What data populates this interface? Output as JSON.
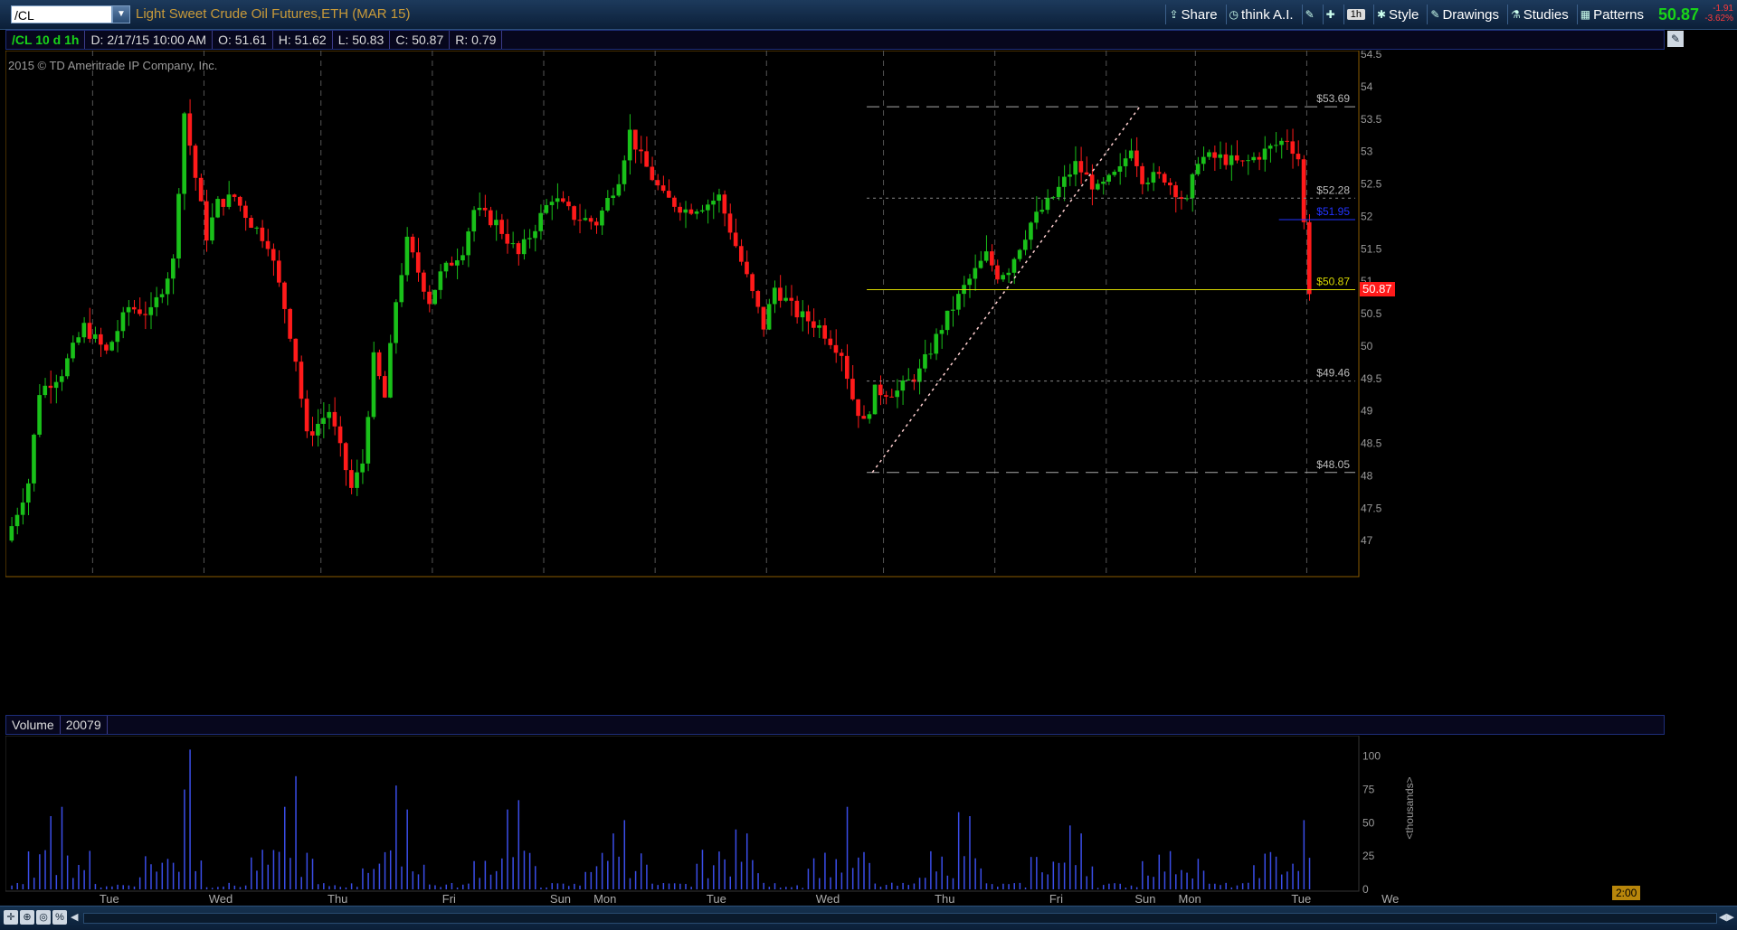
{
  "header": {
    "symbol": "/CL",
    "description": "Light Sweet Crude Oil Futures,ETH (MAR 15)",
    "toolbar": [
      {
        "name": "share-button",
        "icon": "share-icon",
        "label": "Share"
      },
      {
        "name": "think-ai-button",
        "icon": "think-icon",
        "label": "think A.I."
      },
      {
        "name": "drawing-tools-button",
        "icon": "pencil-icon",
        "label": ""
      },
      {
        "name": "settings-button",
        "icon": "wrench-icon",
        "label": ""
      },
      {
        "name": "timeframe-button",
        "icon": "",
        "label": "1h"
      },
      {
        "name": "style-button",
        "icon": "gear-icon",
        "label": "Style"
      },
      {
        "name": "drawings-button",
        "icon": "pencil-icon",
        "label": "Drawings"
      },
      {
        "name": "studies-button",
        "icon": "flask-icon",
        "label": "Studies"
      },
      {
        "name": "patterns-button",
        "icon": "patterns-icon",
        "label": "Patterns"
      }
    ],
    "last_price": "50.87",
    "change": "-1.91",
    "change_pct": "-3.62%"
  },
  "infobar": {
    "symbol": "/CL 10 d 1h",
    "date": "D: 2/17/15 10:00 AM",
    "open": "O: 51.61",
    "high": "H: 51.62",
    "low": "L: 50.83",
    "close": "C: 50.87",
    "range": "R: 0.79"
  },
  "copyright": "2015 © TD Ameritrade IP Company, Inc.",
  "volume_header": {
    "label": "Volume",
    "value": "20079"
  },
  "time_tag": "2:00",
  "colors": {
    "up": "#19c019",
    "down": "#ff1a1a",
    "volume": "#3a4de8",
    "grid": "#555555",
    "hline": "#d8d800",
    "blue_line": "#2233ff"
  },
  "chart_data": {
    "type": "candlestick",
    "price_axis": {
      "min": 46.5,
      "max": 54.5,
      "ticks": [
        "47",
        "47.5",
        "48",
        "48.5",
        "49",
        "49.5",
        "50",
        "50.5",
        "51",
        "51.5",
        "52",
        "52.5",
        "53",
        "53.5",
        "54",
        "54.5"
      ]
    },
    "volume_axis": {
      "min": 0,
      "max": 110,
      "ticks": [
        "0",
        "25",
        "50",
        "75",
        "100"
      ],
      "unit_label": "<thousands>"
    },
    "x_labels": [
      "Tue",
      "Wed",
      "Thu",
      "Fri",
      "Sun",
      "Mon",
      "Tue",
      "Wed",
      "Thu",
      "Fri",
      "Sun",
      "Mon",
      "Tue",
      "We"
    ],
    "x_label_bars": [
      18,
      38,
      59,
      79,
      99,
      107,
      127,
      147,
      168,
      188,
      204,
      212,
      232,
      248
    ],
    "session_dividers": [
      15,
      35,
      56,
      76,
      96,
      116,
      136,
      157,
      177,
      197,
      213,
      233
    ],
    "horizontal_lines": [
      {
        "label": "$53.69",
        "value": 53.69,
        "style": "dashed"
      },
      {
        "label": "$52.28",
        "value": 52.28,
        "style": "dotted"
      },
      {
        "label": "$51.95",
        "value": 51.95,
        "style": "solid-blue"
      },
      {
        "label": "$50.87",
        "value": 50.87,
        "style": "solid-yellow"
      },
      {
        "label": "$49.46",
        "value": 49.46,
        "style": "dotted"
      },
      {
        "label": "$48.05",
        "value": 48.05,
        "style": "dashed"
      }
    ],
    "trendline": {
      "from_bar": 155,
      "from": 48.05,
      "to_bar": 203,
      "to": 53.69
    },
    "current_price_tag": "50.87",
    "bar_count": 234,
    "close_anchors": [
      [
        0,
        47.0
      ],
      [
        4,
        47.9
      ],
      [
        6,
        49.3
      ],
      [
        10,
        49.6
      ],
      [
        14,
        50.3
      ],
      [
        18,
        49.9
      ],
      [
        22,
        50.6
      ],
      [
        26,
        50.5
      ],
      [
        30,
        51.3
      ],
      [
        32,
        53.6
      ],
      [
        34,
        52.6
      ],
      [
        36,
        51.7
      ],
      [
        38,
        52.2
      ],
      [
        41,
        52.3
      ],
      [
        44,
        51.9
      ],
      [
        47,
        51.6
      ],
      [
        50,
        50.6
      ],
      [
        52,
        49.8
      ],
      [
        54,
        48.6
      ],
      [
        58,
        49.0
      ],
      [
        62,
        47.8
      ],
      [
        64,
        48.2
      ],
      [
        66,
        49.8
      ],
      [
        68,
        49.2
      ],
      [
        70,
        50.7
      ],
      [
        72,
        51.6
      ],
      [
        76,
        50.7
      ],
      [
        78,
        51.1
      ],
      [
        82,
        51.5
      ],
      [
        84,
        52.1
      ],
      [
        88,
        51.9
      ],
      [
        92,
        51.4
      ],
      [
        96,
        52.0
      ],
      [
        98,
        52.3
      ],
      [
        102,
        52.0
      ],
      [
        106,
        51.9
      ],
      [
        110,
        52.6
      ],
      [
        112,
        53.3
      ],
      [
        114,
        52.9
      ],
      [
        118,
        52.3
      ],
      [
        122,
        52.1
      ],
      [
        126,
        52.2
      ],
      [
        128,
        52.3
      ],
      [
        132,
        51.3
      ],
      [
        136,
        50.3
      ],
      [
        138,
        50.9
      ],
      [
        142,
        50.5
      ],
      [
        146,
        50.3
      ],
      [
        150,
        49.9
      ],
      [
        152,
        49.2
      ],
      [
        154,
        48.8
      ],
      [
        156,
        49.3
      ],
      [
        160,
        49.3
      ],
      [
        164,
        49.6
      ],
      [
        168,
        50.3
      ],
      [
        172,
        50.9
      ],
      [
        176,
        51.4
      ],
      [
        178,
        51.1
      ],
      [
        180,
        51.2
      ],
      [
        184,
        51.9
      ],
      [
        188,
        52.3
      ],
      [
        192,
        52.8
      ],
      [
        196,
        52.4
      ],
      [
        200,
        52.7
      ],
      [
        202,
        53.1
      ],
      [
        204,
        52.6
      ],
      [
        208,
        52.6
      ],
      [
        212,
        52.2
      ],
      [
        214,
        52.9
      ],
      [
        218,
        52.9
      ],
      [
        222,
        52.8
      ],
      [
        226,
        53.0
      ],
      [
        230,
        53.2
      ],
      [
        232,
        52.9
      ],
      [
        234,
        50.87
      ]
    ],
    "volume_peaks": [
      [
        7,
        55
      ],
      [
        9,
        62
      ],
      [
        31,
        75
      ],
      [
        32,
        105
      ],
      [
        49,
        62
      ],
      [
        51,
        85
      ],
      [
        69,
        78
      ],
      [
        71,
        60
      ],
      [
        89,
        60
      ],
      [
        91,
        67
      ],
      [
        108,
        42
      ],
      [
        110,
        52
      ],
      [
        130,
        45
      ],
      [
        132,
        42
      ],
      [
        150,
        62
      ],
      [
        170,
        58
      ],
      [
        172,
        55
      ],
      [
        190,
        48
      ],
      [
        192,
        42
      ],
      [
        232,
        52
      ]
    ]
  }
}
